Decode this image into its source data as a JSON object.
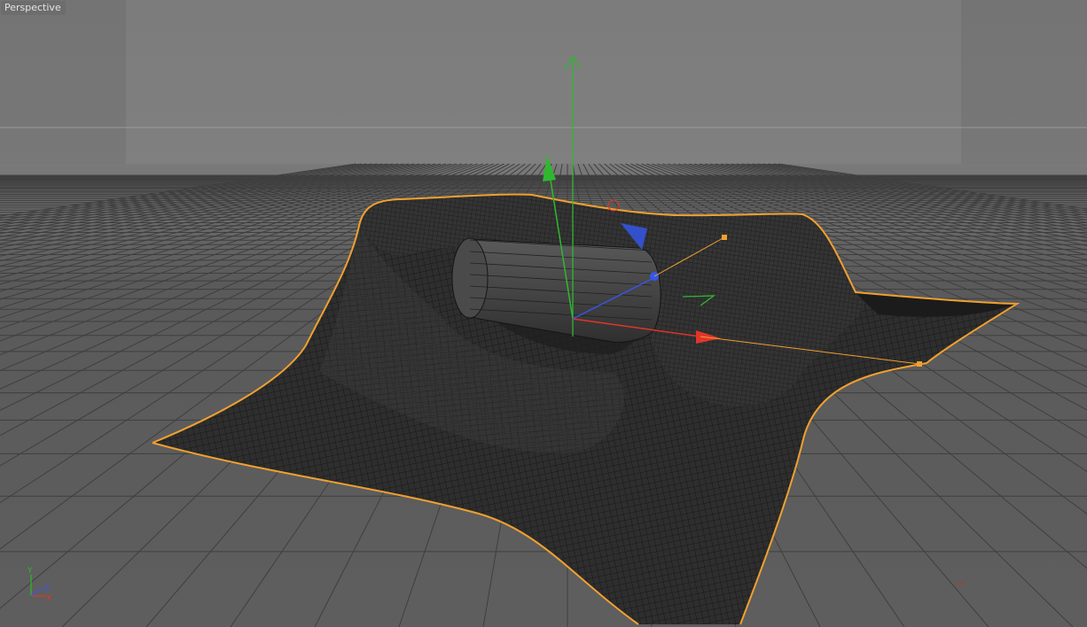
{
  "viewport": {
    "camera_label": "Perspective",
    "colors": {
      "background": "#808080",
      "floor": "#5c5c5c",
      "grid_line": "#4a4a4a",
      "selection_outline": "#f0a030",
      "mesh_fill": "#2c2c2c",
      "mesh_wire": "#111111",
      "axis_x": "#e0352b",
      "axis_y": "#2fb82f",
      "axis_z": "#3557e8",
      "manipulator_handle": "#f0a030"
    },
    "mini_axes": {
      "y": "Y",
      "x": "X",
      "z": "Z"
    },
    "icons": [
      "move-gizmo-icon",
      "rotate-handle-icon",
      "axis-indicator-icon"
    ]
  }
}
